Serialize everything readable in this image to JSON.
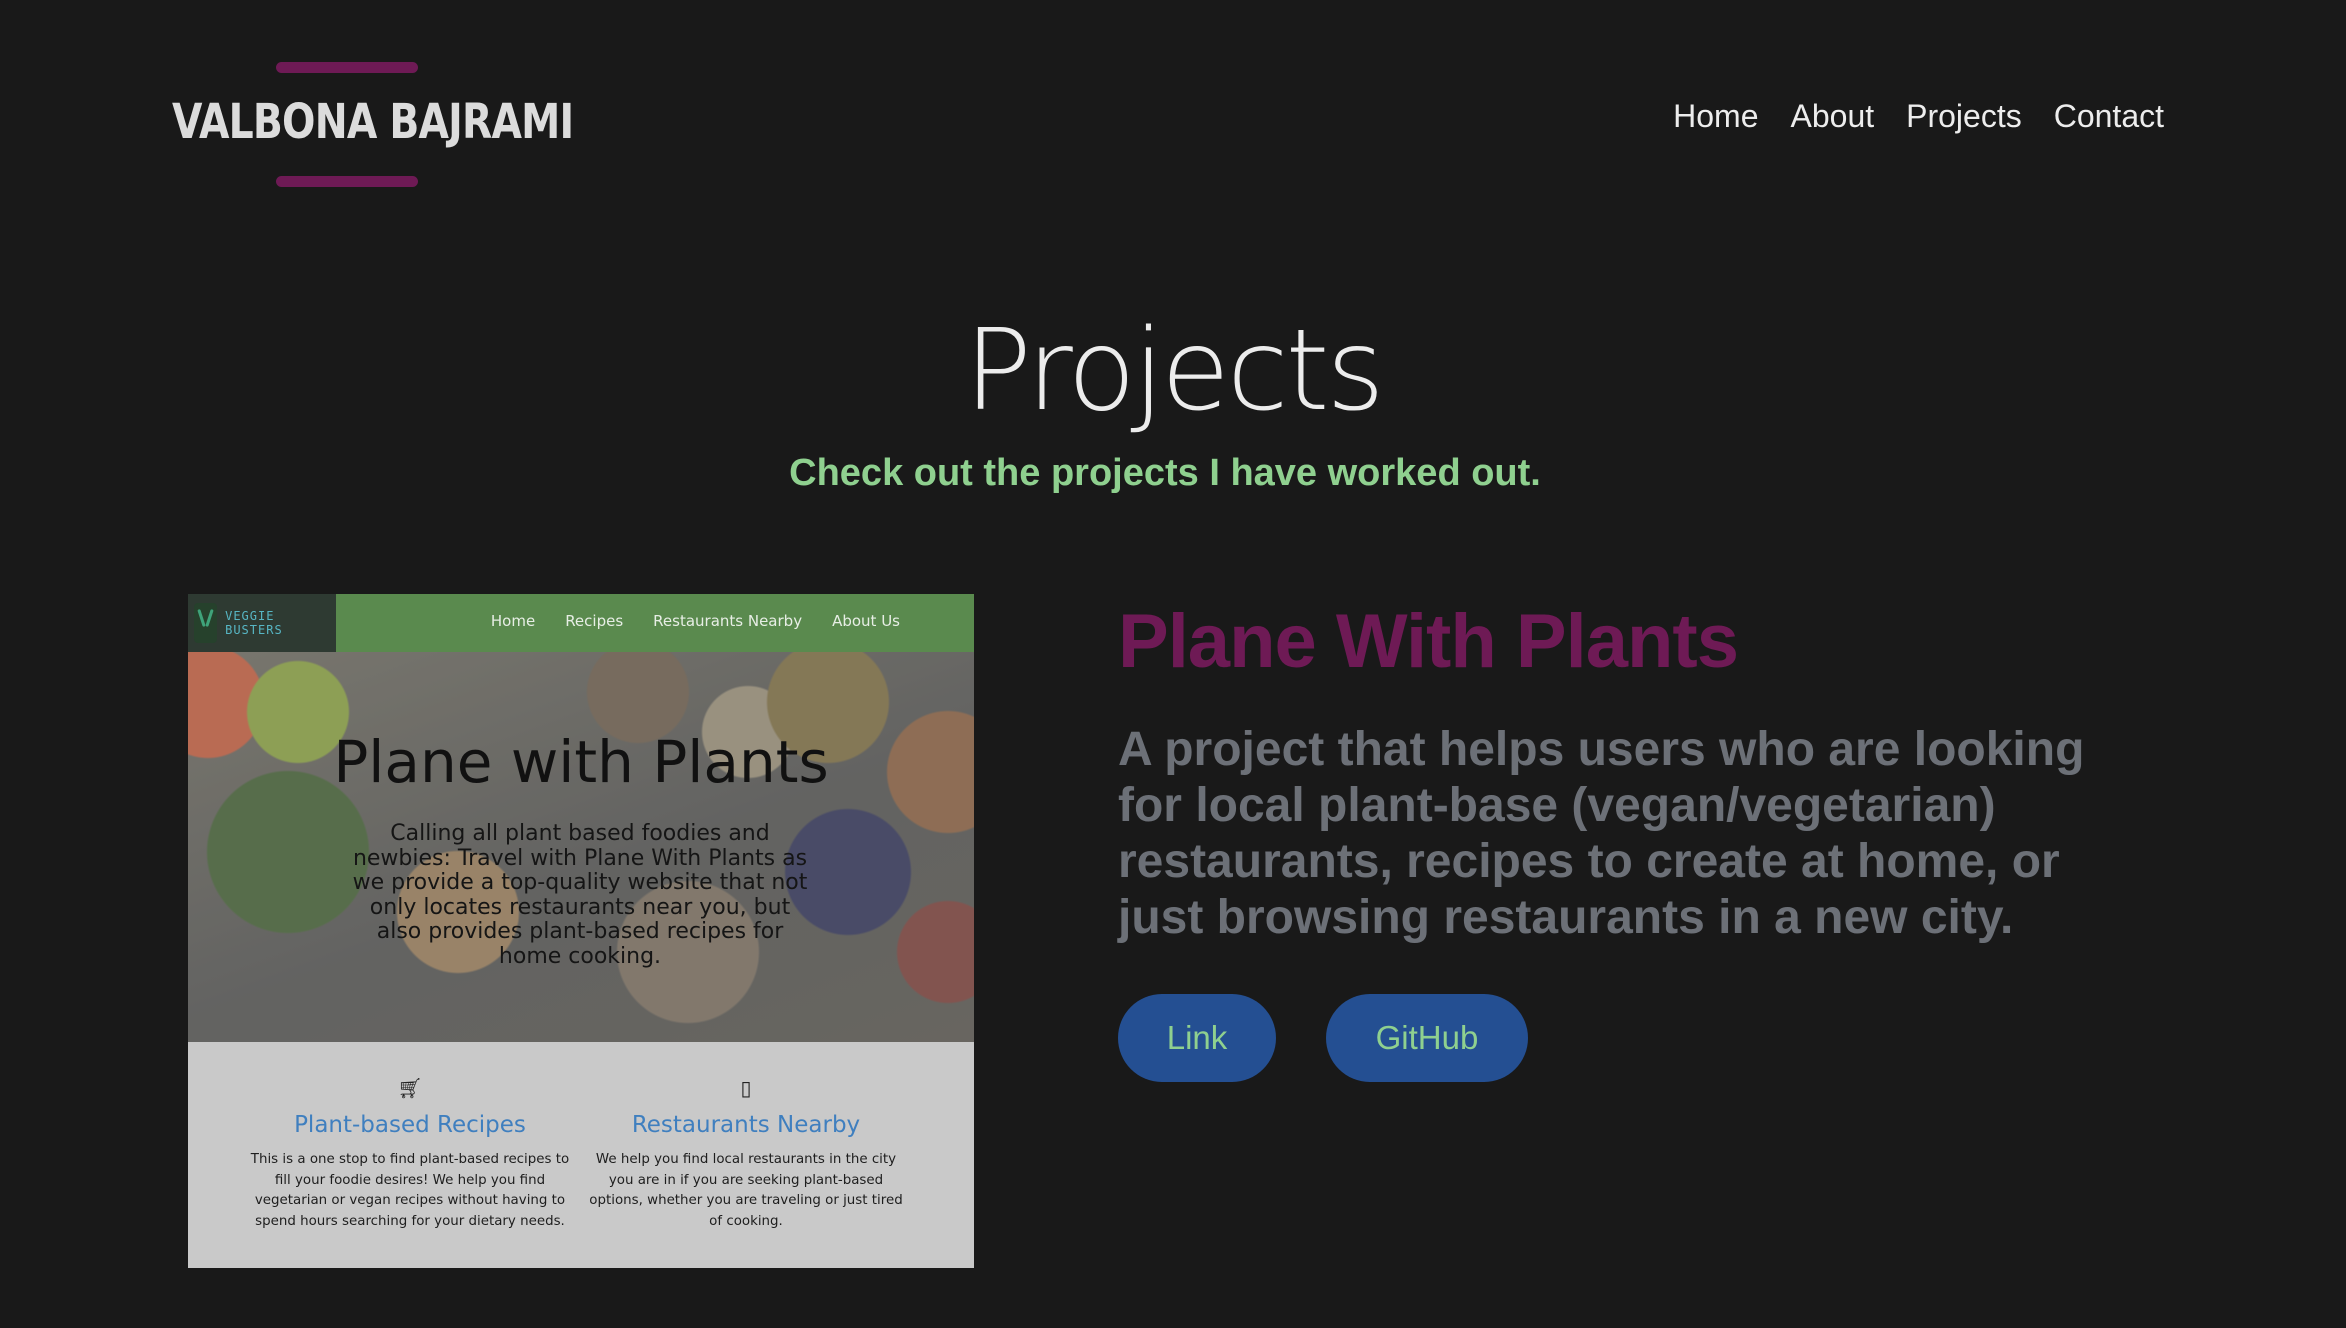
{
  "header": {
    "logo_text": "VALBONA BAJRAMI",
    "nav": [
      "Home",
      "About",
      "Projects",
      "Contact"
    ]
  },
  "hero": {
    "title": "Projects",
    "subtitle": "Check out the projects I have worked out."
  },
  "project": {
    "title": "Plane With Plants",
    "description": "A project that helps users who are looking for local plant-base (vegan/vegetarian) restaurants, recipes to create at home, or just browsing restaurants in a new city.",
    "link_label": "Link",
    "github_label": "GitHub",
    "screenshot": {
      "brand": "VEGGIE BUSTERS",
      "nav": [
        "Home",
        "Recipes",
        "Restaurants Nearby",
        "About Us"
      ],
      "hero_title": "Plane with Plants",
      "hero_text": "Calling all plant based foodies and newbies: Travel with Plane With Plants as we provide a top-quality website that not only locates restaurants near you, but also provides plant-based recipes for home cooking.",
      "features": [
        {
          "icon": "cart-icon",
          "title": "Plant-based Recipes",
          "text": "This is a one stop to find plant-based recipes to fill your foodie desires! We help you find vegetarian or vegan recipes without having to spend hours searching for your dietary needs."
        },
        {
          "icon": "map-icon",
          "title": "Restaurants Nearby",
          "text": "We help you find local restaurants in the city you are in if you are seeking plant-based options, whether you are traveling or just tired of cooking."
        }
      ]
    }
  },
  "colors": {
    "background": "#191919",
    "accent_purple": "#6e1a55",
    "accent_green": "#8fd08f",
    "button_blue": "#244f92",
    "description_gray": "#6c7077"
  }
}
